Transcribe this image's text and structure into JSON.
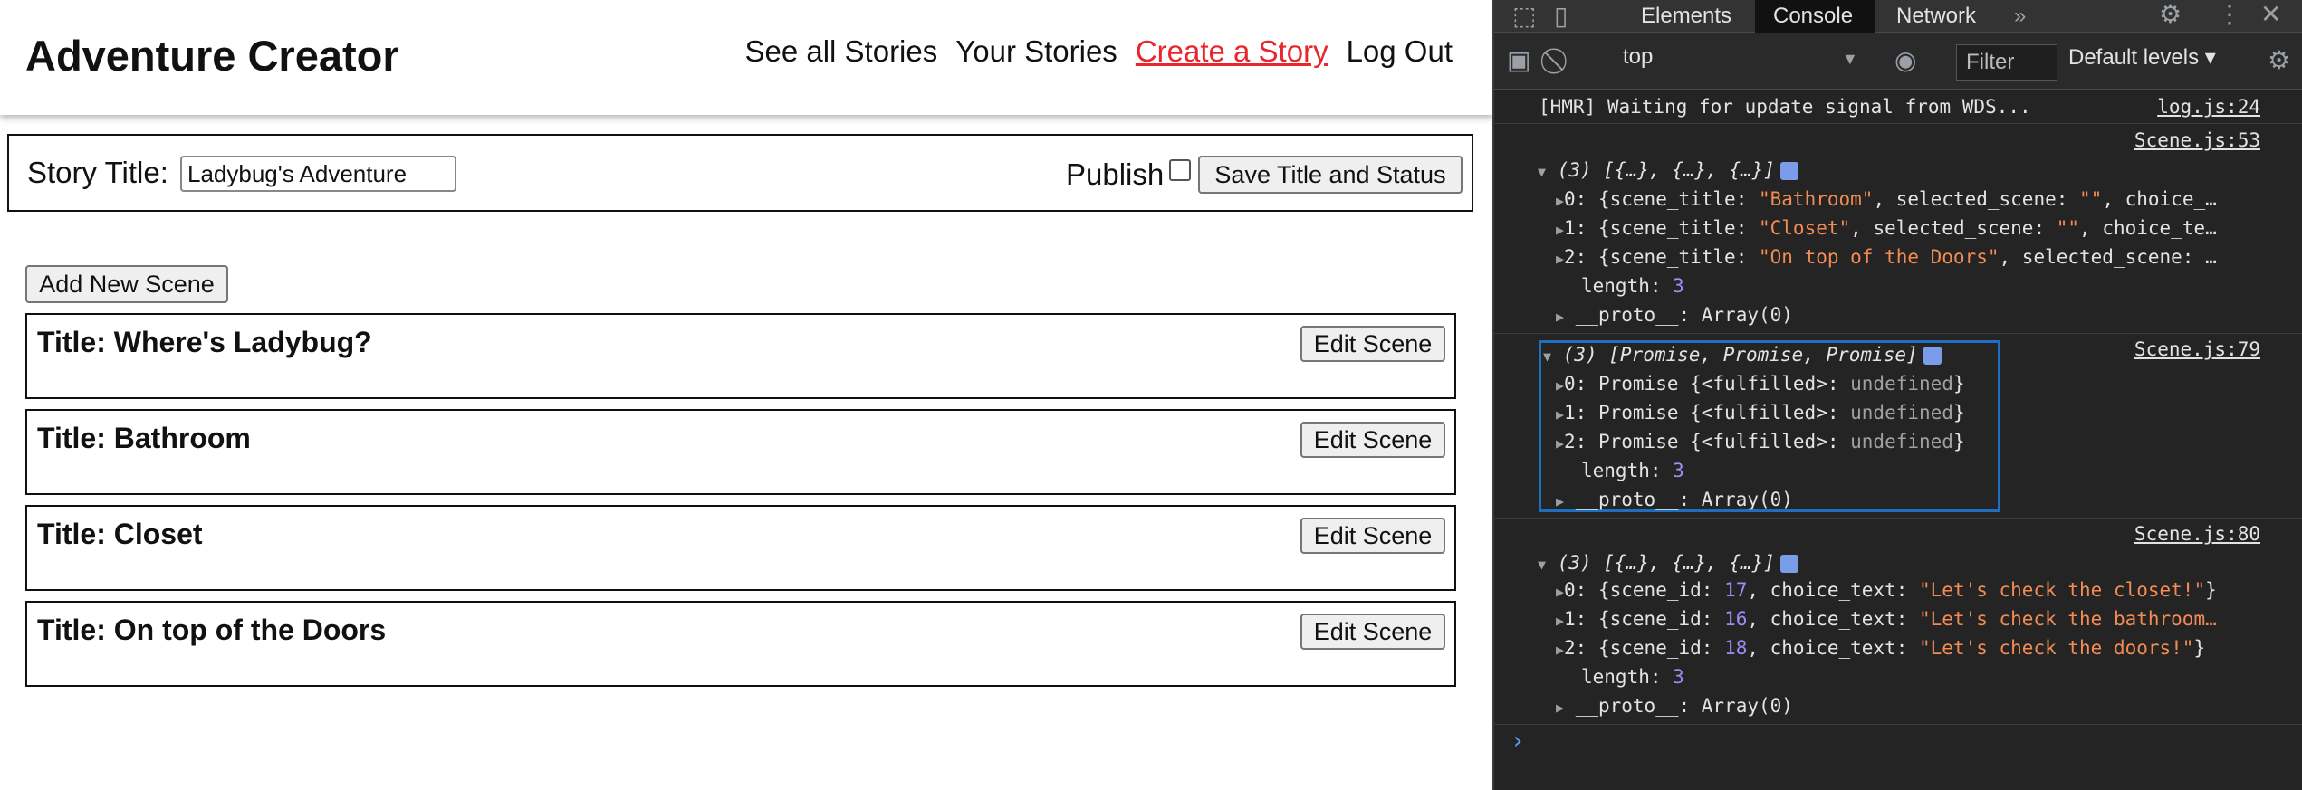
{
  "app": {
    "title": "Adventure Creator",
    "nav": [
      "See all Stories",
      "Your Stories",
      "Create a Story",
      "Log Out"
    ],
    "accent_color": "#e8262c",
    "story": {
      "label": "Story Title:",
      "value": "Ladybug's Adventure",
      "publish_label": "Publish",
      "publish_checked": false,
      "save_label": "Save Title and Status"
    },
    "add_scene_label": "Add New Scene",
    "edit_label": "Edit Scene",
    "scenes": [
      "Title: Where's Ladybug?",
      "Title: Bathroom",
      "Title: Closet",
      "Title: On top of the Doors"
    ]
  },
  "devtools": {
    "tabs": [
      "Elements",
      "Console",
      "Network"
    ],
    "active_tab": "Console",
    "context": "top",
    "filter_placeholder": "Filter",
    "levels": "Default levels",
    "log_hmr": "[HMR] Waiting for update signal from WDS...",
    "src_log": "log.js:24",
    "src_53": "Scene.js:53",
    "src_79": "Scene.js:79",
    "src_80": "Scene.js:80",
    "group1": {
      "header": "(3) [{…}, {…}, {…}]",
      "items": [
        {
          "idx": "0:",
          "pre": "{scene_title: ",
          "val": "\"Bathroom\"",
          "post": ", selected_scene: ",
          "val2": "\"\"",
          "post2": ", choice_…"
        },
        {
          "idx": "1:",
          "pre": "{scene_title: ",
          "val": "\"Closet\"",
          "post": ", selected_scene: ",
          "val2": "\"\"",
          "post2": ", choice_te…"
        },
        {
          "idx": "2:",
          "pre": "{scene_title: ",
          "val": "\"On top of the Doors\"",
          "post": ", selected_scene: …",
          "val2": "",
          "post2": ""
        }
      ],
      "length_key": "length: ",
      "length_val": "3",
      "proto": "__proto__: Array(0)"
    },
    "group2": {
      "header": "(3) [Promise, Promise, Promise]",
      "items": [
        {
          "idx": "0:",
          "pre": "Promise {<fulfilled>: ",
          "val": "undefined",
          "post": "}"
        },
        {
          "idx": "1:",
          "pre": "Promise {<fulfilled>: ",
          "val": "undefined",
          "post": "}"
        },
        {
          "idx": "2:",
          "pre": "Promise {<fulfilled>: ",
          "val": "undefined",
          "post": "}"
        }
      ],
      "length_key": "length: ",
      "length_val": "3",
      "proto": "__proto__: Array(0)"
    },
    "group3": {
      "header": "(3) [{…}, {…}, {…}]",
      "items": [
        {
          "idx": "0:",
          "pre": "{scene_id: ",
          "num": "17",
          "mid": ", choice_text: ",
          "val": "\"Let's check the closet!\"",
          "post": "}"
        },
        {
          "idx": "1:",
          "pre": "{scene_id: ",
          "num": "16",
          "mid": ", choice_text: ",
          "val": "\"Let's check the bathroom…",
          "post": ""
        },
        {
          "idx": "2:",
          "pre": "{scene_id: ",
          "num": "18",
          "mid": ", choice_text: ",
          "val": "\"Let's check the doors!\"",
          "post": "}"
        }
      ],
      "length_key": "length: ",
      "length_val": "3",
      "proto": "__proto__: Array(0)"
    }
  }
}
